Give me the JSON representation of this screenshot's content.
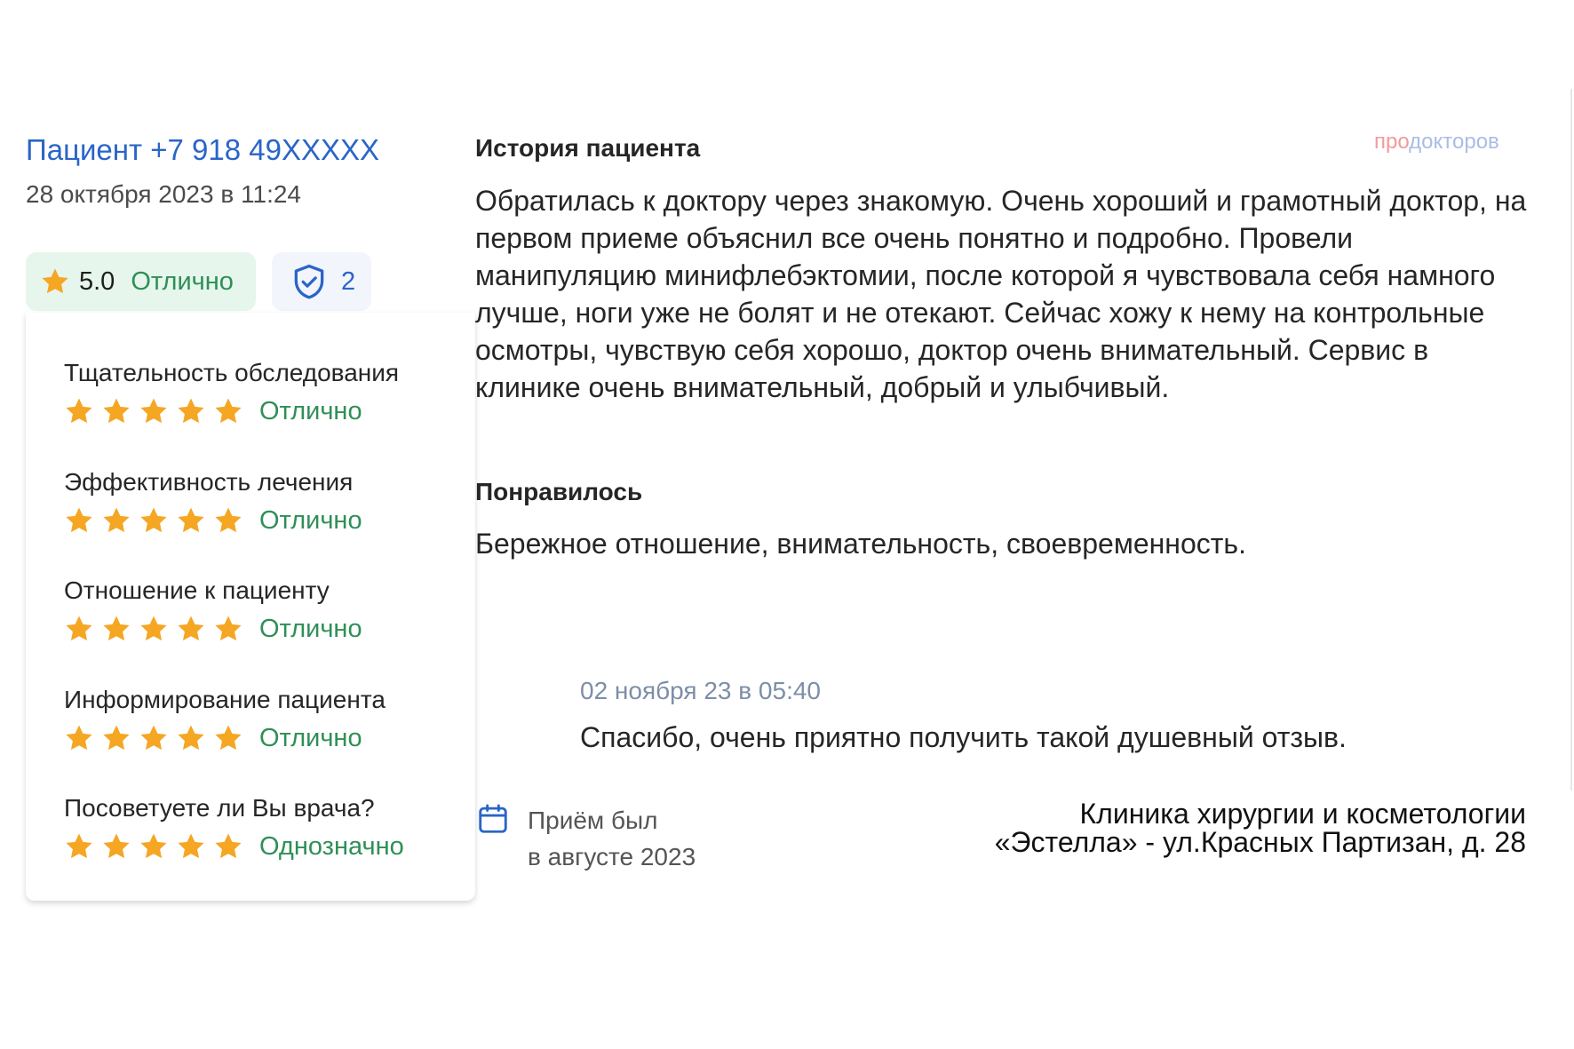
{
  "review": {
    "patient": "Пациент +7 918 49XXXXX",
    "date": "28 октября 2023 в 11:24",
    "score": "5.0",
    "score_word": "Отлично",
    "verified_count": "2",
    "criteria": [
      {
        "label": "Тщательность обследования",
        "stars": 5,
        "value": "Отлично"
      },
      {
        "label": "Эффективность лечения",
        "stars": 5,
        "value": "Отлично"
      },
      {
        "label": "Отношение к пациенту",
        "stars": 5,
        "value": "Отлично"
      },
      {
        "label": "Информирование пациента",
        "stars": 5,
        "value": "Отлично"
      },
      {
        "label": "Посоветуете ли Вы врача?",
        "stars": 5,
        "value": "Однозначно"
      }
    ],
    "history_heading": "История пациента",
    "history_text": "Обратилась к доктору через знакомую. Очень хороший и грамотный доктор, на первом приеме объяснил все очень понятно и подробно. Провели манипуляцию минифлебэктомии, после которой я чувствовала себя намного лучше, ноги уже не болят и не отекают. Сейчас хожу к нему на контрольные осмотры, чувствую себя хорошо, доктор очень внимательный. Сервис в клинике очень внимательный, добрый и улыбчивый.",
    "liked_heading": "Понравилось",
    "liked_text": "Бережное отношение, внимательность, своевременность.",
    "reply_date": "02 ноября 23 в 05:40",
    "reply_text": "Спасибо, очень приятно получить такой душевный отзыв.",
    "visit_line1": "Приём был",
    "visit_line2": "в августе 2023",
    "clinic": "Клиника хирургии и косметологии «Эстелла» - ул.Красных Партизан, д. 28"
  },
  "logo": {
    "part1": "про",
    "part2": "докторов"
  },
  "icons": {
    "star": "star-icon",
    "shield": "shield-check-icon",
    "calendar": "calendar-icon"
  },
  "colors": {
    "link": "#2a65c8",
    "positive": "#2f8f57",
    "star": "#f5a623",
    "badge_bg": "#e6f6ec"
  }
}
